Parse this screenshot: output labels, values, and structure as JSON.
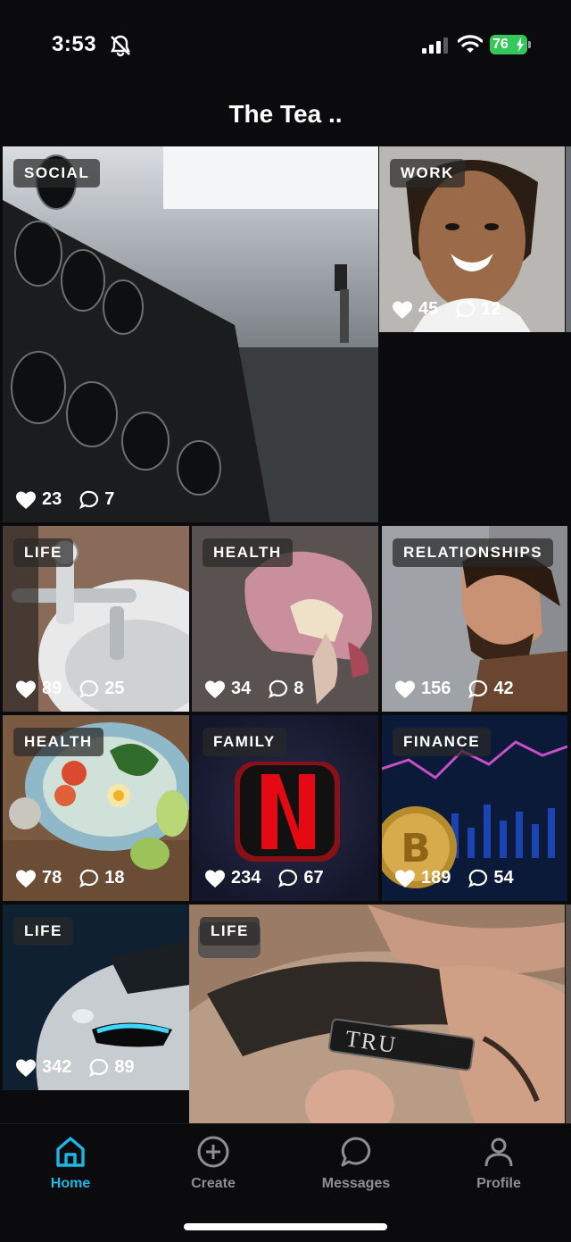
{
  "status": {
    "time": "3:53",
    "battery": "76",
    "icons": [
      "bell-slash-icon",
      "cellular-signal-icon",
      "wifi-icon",
      "battery-charging-icon"
    ]
  },
  "header": {
    "title": "The Tea .."
  },
  "posts": [
    {
      "category": "SOCIAL",
      "likes": "23",
      "comments": "7",
      "image": "gym dumbbell rack"
    },
    {
      "category": "WORK",
      "likes": "45",
      "comments": "12",
      "image": "smiling man portrait"
    },
    {
      "category": "LIFE",
      "likes": "89",
      "comments": "25",
      "image": "bathtub faucet"
    },
    {
      "category": "HEALTH",
      "likes": "34",
      "comments": "8",
      "image": "brain model"
    },
    {
      "category": "RELATIONSHIPS",
      "likes": "156",
      "comments": "42",
      "image": "laughing bearded man"
    },
    {
      "category": "HEALTH",
      "likes": "78",
      "comments": "18",
      "image": "salad bowl"
    },
    {
      "category": "FAMILY",
      "likes": "234",
      "comments": "67",
      "image": "netflix logo"
    },
    {
      "category": "FINANCE",
      "likes": "189",
      "comments": "54",
      "image": "bitcoin coin"
    },
    {
      "category": "LIFE",
      "likes": "342",
      "comments": "89",
      "image": "sports car headlight"
    },
    {
      "category": "LIFE",
      "likes": "",
      "comments": "",
      "image": "barber razor haircut",
      "razor_text": "TRU"
    }
  ],
  "nav": {
    "items": [
      {
        "label": "Home",
        "icon": "home-icon",
        "active": true
      },
      {
        "label": "Create",
        "icon": "plus-circle-icon",
        "active": false
      },
      {
        "label": "Messages",
        "icon": "chat-bubble-icon",
        "active": false
      },
      {
        "label": "Profile",
        "icon": "person-icon",
        "active": false
      }
    ]
  },
  "colors": {
    "accent": "#19b8e6",
    "background": "#0b0b0d",
    "inactive": "#8e8e93",
    "battery": "#34c759"
  }
}
